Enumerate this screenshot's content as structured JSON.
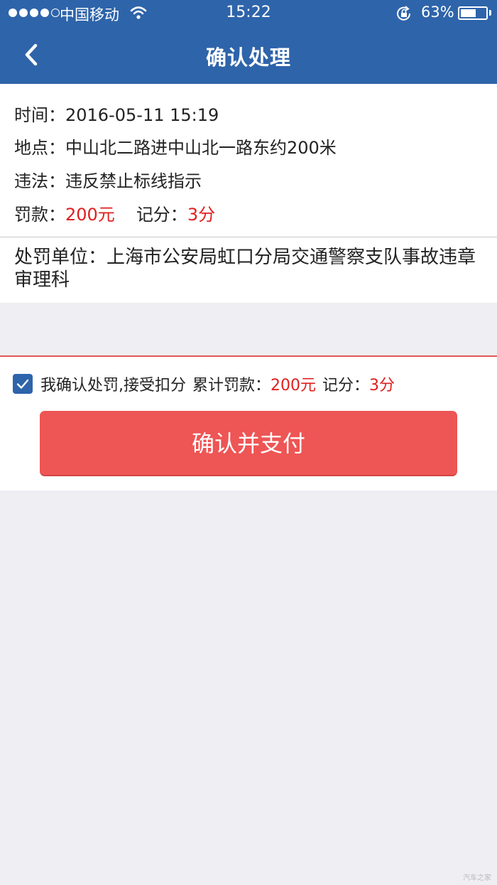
{
  "status_bar": {
    "carrier": "中国移动",
    "time": "15:22",
    "battery_percent": "63%",
    "battery_level": 0.63,
    "signal_bars": 4
  },
  "navbar": {
    "back_icon": "chevron-left-icon",
    "title": "确认处理"
  },
  "violation": {
    "time_label": "时间：",
    "time_value": "2016-05-11 15:19",
    "location_label": "地点：",
    "location_value": "中山北二路进中山北一路东约200米",
    "violation_label": "违法：",
    "violation_value": "违反禁止标线指示",
    "fine_label": "罚款：",
    "fine_value": "200元",
    "points_label": "记分：",
    "points_value": "3分",
    "unit_label": "处罚单位：",
    "unit_value": "上海市公安局虹口分局交通警察支队事故违章审理科"
  },
  "confirm": {
    "checked": true,
    "text": "我确认处罚,接受扣分",
    "total_fine_label": "累计罚款：",
    "total_fine_value": "200元",
    "points_label": "记分：",
    "points_value": "3分",
    "button_label": "确认并支付"
  },
  "watermark": "汽车之家",
  "colors": {
    "header_bg": "#2e64aa",
    "accent_red": "#e01e1e",
    "button_bg": "#ee5555",
    "page_bg": "#eeeef3"
  }
}
